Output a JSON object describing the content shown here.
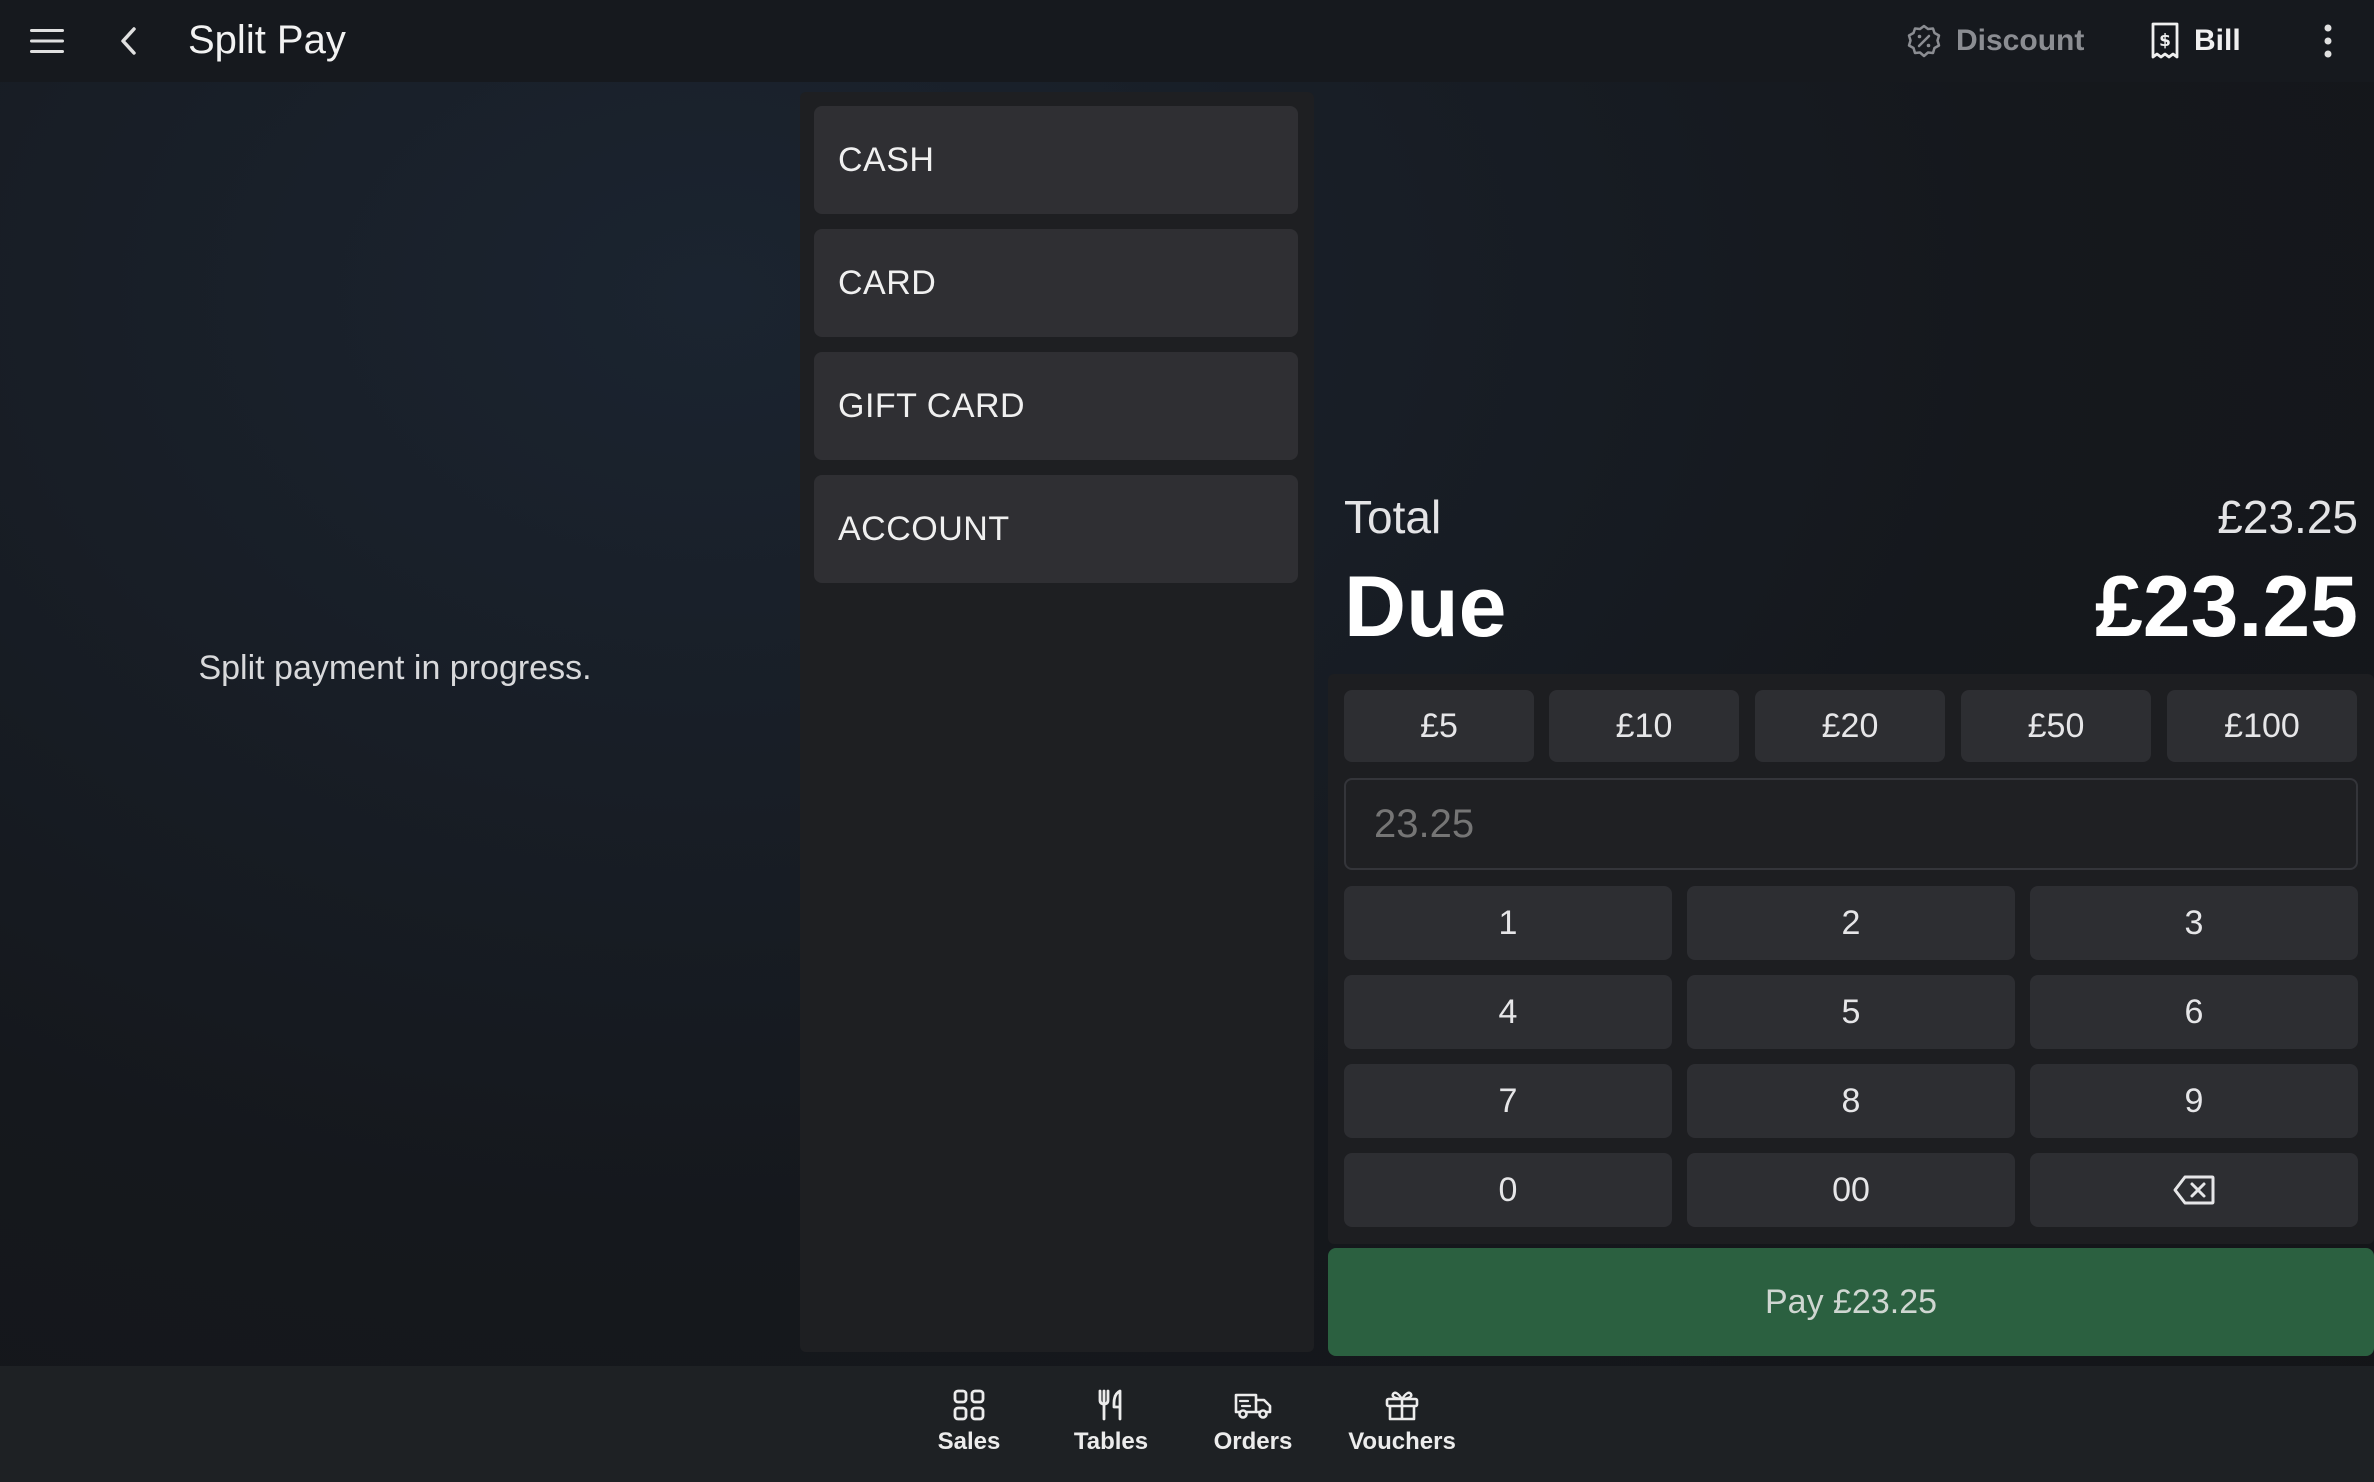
{
  "header": {
    "title": "Split Pay",
    "discount_label": "Discount",
    "bill_label": "Bill"
  },
  "left_panel": {
    "message": "Split payment in progress."
  },
  "payment_methods": [
    {
      "label": "CASH"
    },
    {
      "label": "CARD"
    },
    {
      "label": "GIFT CARD"
    },
    {
      "label": "ACCOUNT"
    }
  ],
  "summary": {
    "total_label": "Total",
    "total_value": "£23.25",
    "due_label": "Due",
    "due_value": "£23.25"
  },
  "quick_amounts": [
    "£5",
    "£10",
    "£20",
    "£50",
    "£100"
  ],
  "amount_input": {
    "placeholder": "23.25"
  },
  "keypad": {
    "keys": [
      "1",
      "2",
      "3",
      "4",
      "5",
      "6",
      "7",
      "8",
      "9",
      "0",
      "00"
    ],
    "backspace_icon": "backspace-icon"
  },
  "pay_button": {
    "label": "Pay £23.25"
  },
  "bottom_nav": [
    {
      "label": "Sales",
      "icon": "grid-icon"
    },
    {
      "label": "Tables",
      "icon": "utensils-icon"
    },
    {
      "label": "Orders",
      "icon": "delivery-truck-icon"
    },
    {
      "label": "Vouchers",
      "icon": "gift-icon"
    }
  ],
  "colors": {
    "pay_button": "#2b6040",
    "background": "#15171b",
    "button": "#2d2e32"
  }
}
